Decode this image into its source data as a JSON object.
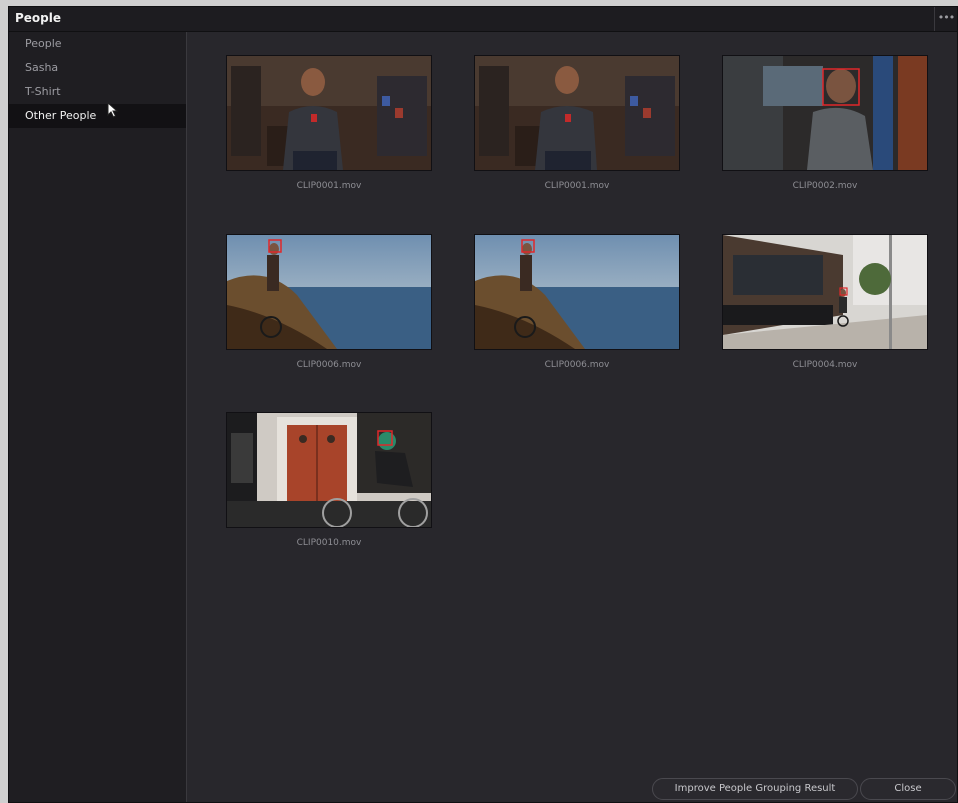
{
  "window": {
    "title": "People",
    "menu_icon": "more-dots-icon"
  },
  "sidebar": {
    "items": [
      {
        "label": "People"
      },
      {
        "label": "Sasha"
      },
      {
        "label": "T-Shirt"
      },
      {
        "label": "Other People",
        "selected": true
      }
    ]
  },
  "clips": [
    {
      "name": "CLIP0001.mov",
      "scene": "workshop-interview"
    },
    {
      "name": "CLIP0001.mov",
      "scene": "workshop-interview"
    },
    {
      "name": "CLIP0002.mov",
      "scene": "man-by-window"
    },
    {
      "name": "CLIP0006.mov",
      "scene": "cyclist-coast"
    },
    {
      "name": "CLIP0006.mov",
      "scene": "cyclist-coast"
    },
    {
      "name": "CLIP0004.mov",
      "scene": "street-storefront"
    },
    {
      "name": "CLIP0010.mov",
      "scene": "cyclist-red-door"
    }
  ],
  "buttons": {
    "improve": "Improve People Grouping Result",
    "close": "Close"
  },
  "colors": {
    "face_box": "#e0282a",
    "panel_bg": "#28272c",
    "sidebar_bg": "#1f1e22"
  }
}
